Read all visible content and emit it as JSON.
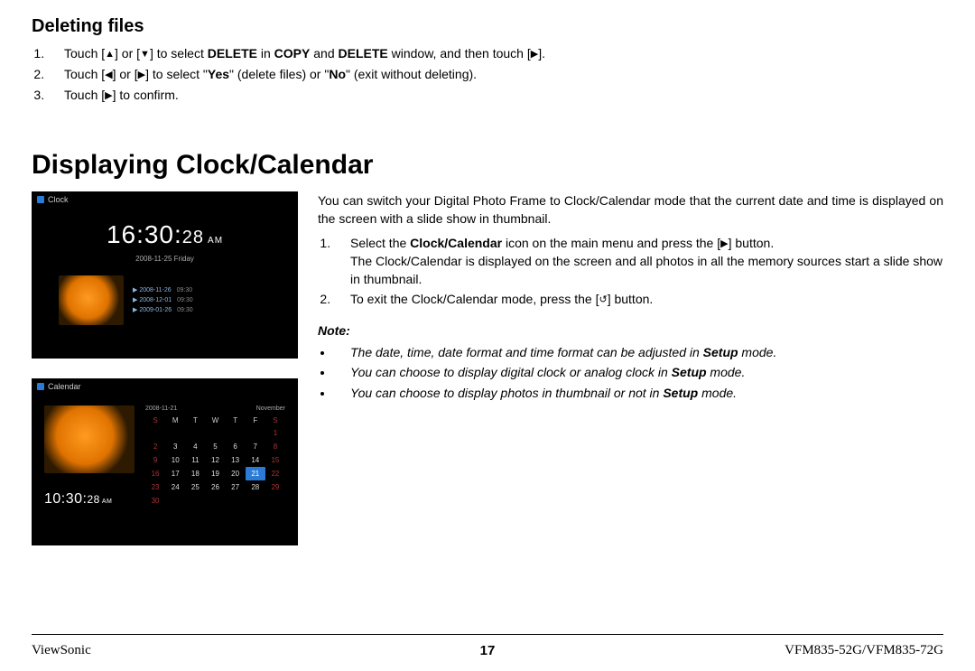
{
  "section1": {
    "title": "Deleting files",
    "steps": [
      {
        "pre": "Touch [",
        "g1": "▲",
        "mid1": "] or [",
        "g2": "▼",
        "mid2": "] to select ",
        "b1": "DELETE",
        "mid3": " in ",
        "b2": "COPY",
        "mid4": " and ",
        "b3": "DELETE",
        "mid5": " window, and then touch [",
        "g3": "▶",
        "post": "]."
      },
      {
        "pre": "Touch [",
        "g1": "◀",
        "mid1": "] or [",
        "g2": "▶",
        "mid2": "] to select \"",
        "b1": "Yes",
        "mid3": "\" (delete files) or \"",
        "b2": "No",
        "mid4": "\" (exit without deleting).",
        "b3": "",
        "mid5": "",
        "g3": "",
        "post": ""
      },
      {
        "pre": "Touch [",
        "g1": "▶",
        "mid1": "] to confirm.",
        "g2": "",
        "mid2": "",
        "b1": "",
        "mid3": "",
        "b2": "",
        "mid4": "",
        "b3": "",
        "mid5": "",
        "g3": "",
        "post": ""
      }
    ]
  },
  "section2": {
    "title": "Displaying Clock/Calendar",
    "intro": "You can switch your Digital Photo Frame to Clock/Calendar mode that the current date and time is displayed on the screen with a slide show in thumbnail.",
    "steps": [
      {
        "pre": "Select the ",
        "b1": "Clock/Calendar",
        "mid1": " icon on the main menu and press the [",
        "g1": "▶",
        "mid2": "] button.",
        "cont": "The Clock/Calendar is displayed on the screen and all photos in all the memory sources start a slide show in thumbnail."
      },
      {
        "pre": "To exit the Clock/Calendar mode, press the [",
        "b1": "",
        "mid1": "",
        "g1": "↺",
        "mid2": "] button.",
        "cont": ""
      }
    ],
    "note_label": "Note:",
    "notes": [
      {
        "t1": "The date, time, date format and time format can be adjusted in ",
        "b": "Setup",
        "t2": " mode."
      },
      {
        "t1": "You can choose to display digital clock or analog clock in ",
        "b": "Setup",
        "t2": " mode."
      },
      {
        "t1": "You can choose to display photos in thumbnail or not in ",
        "b": "Setup",
        "t2": " mode."
      }
    ]
  },
  "clock_shot": {
    "label": "Clock",
    "time_hm": "16:30:",
    "time_s": "28",
    "ampm": "AM",
    "date": "2008-11-25    Friday",
    "events": [
      {
        "d": "2008-11-26",
        "t": "09:30"
      },
      {
        "d": "2008-12-01",
        "t": "09:30"
      },
      {
        "d": "2009-01-26",
        "t": "09:30"
      }
    ]
  },
  "cal_shot": {
    "label": "Calendar",
    "date": "2008-11-21",
    "month": "November",
    "time_hm": "10:30:",
    "time_s": "28",
    "ampm": "AM",
    "dow": [
      "S",
      "M",
      "T",
      "W",
      "T",
      "F",
      "S"
    ],
    "rows": [
      [
        "",
        "",
        "",
        "",
        "",
        "",
        "1"
      ],
      [
        "2",
        "3",
        "4",
        "5",
        "6",
        "7",
        "8"
      ],
      [
        "9",
        "10",
        "11",
        "12",
        "13",
        "14",
        "15"
      ],
      [
        "16",
        "17",
        "18",
        "19",
        "20",
        "21",
        "22"
      ],
      [
        "23",
        "24",
        "25",
        "26",
        "27",
        "28",
        "29"
      ],
      [
        "30",
        "",
        "",
        "",
        "",
        "",
        ""
      ]
    ],
    "highlight": "21"
  },
  "footer": {
    "brand": "ViewSonic",
    "page": "17",
    "model": "VFM835-52G/VFM835-72G"
  }
}
